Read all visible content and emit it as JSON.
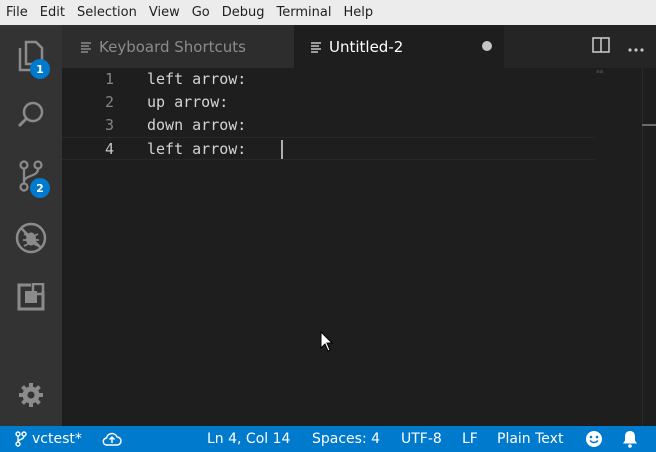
{
  "menu": [
    "File",
    "Edit",
    "Selection",
    "View",
    "Go",
    "Debug",
    "Terminal",
    "Help"
  ],
  "activity_bar": {
    "explorer_badge": "1",
    "scm_badge": "2"
  },
  "tabs": [
    {
      "label": "Keyboard Shortcuts",
      "active": false
    },
    {
      "label": "Untitled-2",
      "active": true,
      "dirty": true
    }
  ],
  "editor": {
    "lines": [
      {
        "number": "1",
        "text": "left arrow:"
      },
      {
        "number": "2",
        "text": "up arrow:"
      },
      {
        "number": "3",
        "text": "down arrow:"
      },
      {
        "number": "4",
        "text": "left arrow: "
      }
    ]
  },
  "status_bar": {
    "branch": "vctest*",
    "position": "Ln 4, Col 14",
    "indent": "Spaces: 4",
    "encoding": "UTF-8",
    "eol": "LF",
    "language": "Plain Text"
  },
  "colors": {
    "accent": "#007acc",
    "activity_bar": "#333333",
    "editor_bg": "#1e1e1e",
    "menu_bg": "#ececec"
  }
}
